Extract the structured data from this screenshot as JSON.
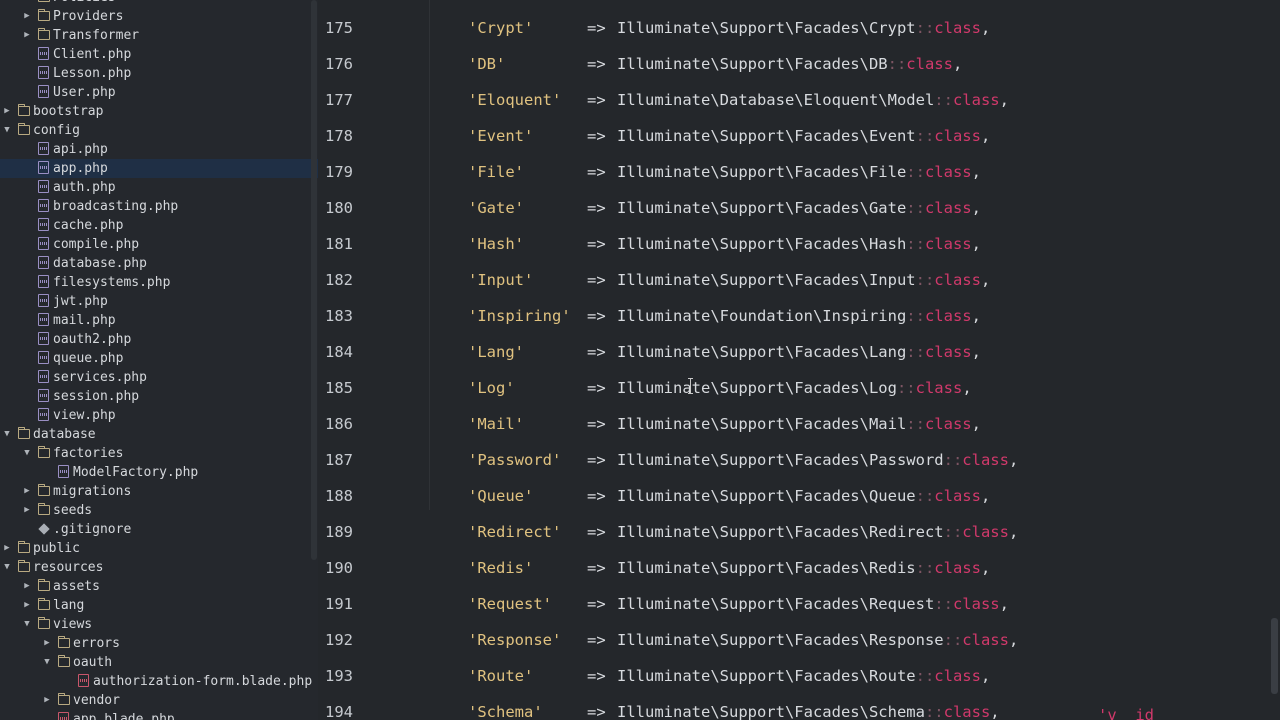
{
  "sidebar": {
    "items": [
      {
        "label": "Policies",
        "type": "folder",
        "depth": 1,
        "arrow": "right"
      },
      {
        "label": "Providers",
        "type": "folder",
        "depth": 1,
        "arrow": "right"
      },
      {
        "label": "Transformer",
        "type": "folder",
        "depth": 1,
        "arrow": "right"
      },
      {
        "label": "Client.php",
        "type": "php",
        "depth": 1
      },
      {
        "label": "Lesson.php",
        "type": "php",
        "depth": 1
      },
      {
        "label": "User.php",
        "type": "php",
        "depth": 1
      },
      {
        "label": "bootstrap",
        "type": "folder",
        "depth": 0,
        "arrow": "right"
      },
      {
        "label": "config",
        "type": "folder",
        "depth": 0,
        "arrow": "down"
      },
      {
        "label": "api.php",
        "type": "php",
        "depth": 1
      },
      {
        "label": "app.php",
        "type": "php",
        "depth": 1,
        "selected": true
      },
      {
        "label": "auth.php",
        "type": "php",
        "depth": 1
      },
      {
        "label": "broadcasting.php",
        "type": "php",
        "depth": 1
      },
      {
        "label": "cache.php",
        "type": "php",
        "depth": 1
      },
      {
        "label": "compile.php",
        "type": "php",
        "depth": 1
      },
      {
        "label": "database.php",
        "type": "php",
        "depth": 1
      },
      {
        "label": "filesystems.php",
        "type": "php",
        "depth": 1
      },
      {
        "label": "jwt.php",
        "type": "php",
        "depth": 1
      },
      {
        "label": "mail.php",
        "type": "php",
        "depth": 1
      },
      {
        "label": "oauth2.php",
        "type": "php",
        "depth": 1
      },
      {
        "label": "queue.php",
        "type": "php",
        "depth": 1
      },
      {
        "label": "services.php",
        "type": "php",
        "depth": 1
      },
      {
        "label": "session.php",
        "type": "php",
        "depth": 1
      },
      {
        "label": "view.php",
        "type": "php",
        "depth": 1
      },
      {
        "label": "database",
        "type": "folder",
        "depth": 0,
        "arrow": "down"
      },
      {
        "label": "factories",
        "type": "folder",
        "depth": 1,
        "arrow": "down"
      },
      {
        "label": "ModelFactory.php",
        "type": "php",
        "depth": 2
      },
      {
        "label": "migrations",
        "type": "folder",
        "depth": 1,
        "arrow": "right"
      },
      {
        "label": "seeds",
        "type": "folder",
        "depth": 1,
        "arrow": "right"
      },
      {
        "label": ".gitignore",
        "type": "git",
        "depth": 1
      },
      {
        "label": "public",
        "type": "folder",
        "depth": 0,
        "arrow": "right"
      },
      {
        "label": "resources",
        "type": "folder",
        "depth": 0,
        "arrow": "down"
      },
      {
        "label": "assets",
        "type": "folder",
        "depth": 1,
        "arrow": "right"
      },
      {
        "label": "lang",
        "type": "folder",
        "depth": 1,
        "arrow": "right"
      },
      {
        "label": "views",
        "type": "folder",
        "depth": 1,
        "arrow": "down"
      },
      {
        "label": "errors",
        "type": "folder",
        "depth": 2,
        "arrow": "right"
      },
      {
        "label": "oauth",
        "type": "folder",
        "depth": 2,
        "arrow": "down"
      },
      {
        "label": "authorization-form.blade.php",
        "type": "blade",
        "depth": 3
      },
      {
        "label": "vendor",
        "type": "folder",
        "depth": 2,
        "arrow": "right"
      },
      {
        "label": "app.blade.php",
        "type": "blade",
        "depth": 2
      }
    ]
  },
  "editor": {
    "lines": [
      {
        "n": "175",
        "key": "'Crypt'",
        "ns": "Illuminate\\Support\\Facades\\Crypt"
      },
      {
        "n": "176",
        "key": "'DB'",
        "ns": "Illuminate\\Support\\Facades\\DB"
      },
      {
        "n": "177",
        "key": "'Eloquent'",
        "ns": "Illuminate\\Database\\Eloquent\\Model"
      },
      {
        "n": "178",
        "key": "'Event'",
        "ns": "Illuminate\\Support\\Facades\\Event"
      },
      {
        "n": "179",
        "key": "'File'",
        "ns": "Illuminate\\Support\\Facades\\File"
      },
      {
        "n": "180",
        "key": "'Gate'",
        "ns": "Illuminate\\Support\\Facades\\Gate"
      },
      {
        "n": "181",
        "key": "'Hash'",
        "ns": "Illuminate\\Support\\Facades\\Hash"
      },
      {
        "n": "182",
        "key": "'Input'",
        "ns": "Illuminate\\Support\\Facades\\Input"
      },
      {
        "n": "183",
        "key": "'Inspiring'",
        "ns": "Illuminate\\Foundation\\Inspiring"
      },
      {
        "n": "184",
        "key": "'Lang'",
        "ns": "Illuminate\\Support\\Facades\\Lang"
      },
      {
        "n": "185",
        "key": "'Log'",
        "ns": "Illuminate\\Support\\Facades\\Log"
      },
      {
        "n": "186",
        "key": "'Mail'",
        "ns": "Illuminate\\Support\\Facades\\Mail"
      },
      {
        "n": "187",
        "key": "'Password'",
        "ns": "Illuminate\\Support\\Facades\\Password"
      },
      {
        "n": "188",
        "key": "'Queue'",
        "ns": "Illuminate\\Support\\Facades\\Queue"
      },
      {
        "n": "189",
        "key": "'Redirect'",
        "ns": "Illuminate\\Support\\Facades\\Redirect"
      },
      {
        "n": "190",
        "key": "'Redis'",
        "ns": "Illuminate\\Support\\Facades\\Redis"
      },
      {
        "n": "191",
        "key": "'Request'",
        "ns": "Illuminate\\Support\\Facades\\Request"
      },
      {
        "n": "192",
        "key": "'Response'",
        "ns": "Illuminate\\Support\\Facades\\Response"
      },
      {
        "n": "193",
        "key": "'Route'",
        "ns": "Illuminate\\Support\\Facades\\Route"
      },
      {
        "n": "194",
        "key": "'Schema'",
        "ns": "Illuminate\\Support\\Facades\\Schema"
      }
    ],
    "arrow_token": "=>",
    "class_colons": "::",
    "class_keyword": "class",
    "comma": ",",
    "partial_text": "'v  id"
  },
  "colors": {
    "background": "#24272b",
    "string": "#e0c280",
    "class_keyword": "#d0396b",
    "selection": "#1f2f45"
  }
}
